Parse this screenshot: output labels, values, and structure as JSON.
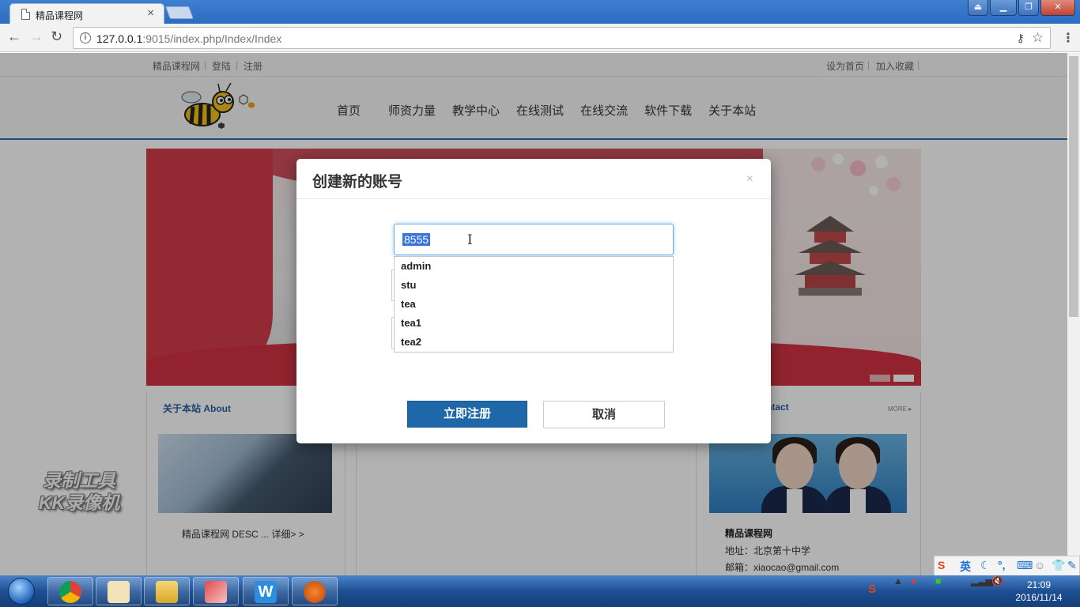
{
  "browser": {
    "tab_title": "精品课程网",
    "url_host": "127.0.0.1",
    "url_rest": ":9015/index.php/Index/Index",
    "colors": {
      "titlebar": "#2d6cc0",
      "accent": "#1e67a8"
    }
  },
  "topbar": {
    "left_links": [
      "精品课程网",
      "登陆",
      "注册"
    ],
    "right_links": [
      "设为首页",
      "加入收藏"
    ]
  },
  "nav": {
    "items": [
      "首页",
      "师资力量",
      "教学中心",
      "在线测试",
      "在线交流",
      "软件下载",
      "关于本站"
    ]
  },
  "sections": {
    "about_title": "关于本站 About",
    "contact_title_partial": "ntact",
    "more": "MORE ▸",
    "about_desc": "精品课程网 DESC ... 详细> >",
    "contact": {
      "name": "精品课程网",
      "address": "地址：北京第十中学",
      "email": "邮箱：xiaocao@gmail.com"
    }
  },
  "watermark": {
    "line1": "录制工具",
    "line2": "KK录像机"
  },
  "modal": {
    "title": "创建新的账号",
    "close": "×",
    "input_value": "8555",
    "autocomplete_options": [
      "admin",
      "stu",
      "tea",
      "tea1",
      "tea2"
    ],
    "submit_label": "立即注册",
    "cancel_label": "取消"
  },
  "taskbar": {
    "time": "21:09",
    "date": "2016/11/14",
    "ime_label": "英"
  }
}
